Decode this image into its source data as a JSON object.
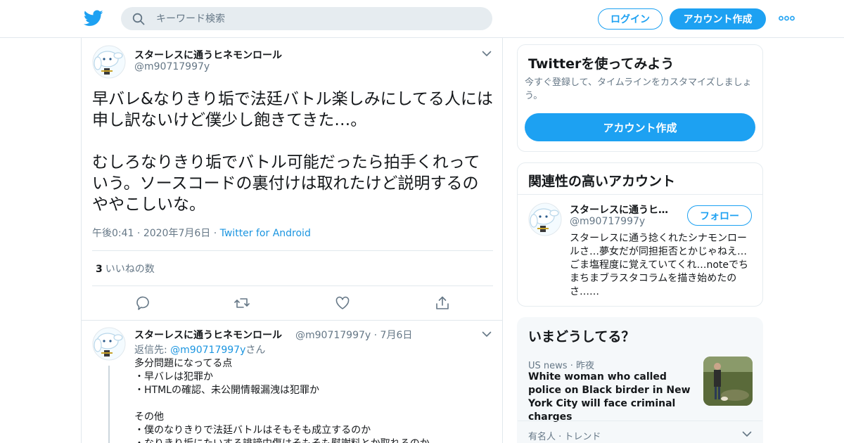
{
  "header": {
    "search_placeholder": "キーワード検索",
    "login_label": "ログイン",
    "signup_label": "アカウント作成"
  },
  "main_tweet": {
    "display_name": "スターレスに通うヒネモンロール",
    "handle": "@m90717997y",
    "text": "早バレ&なりきり垢で法廷バトル楽しみにしてる人には申し訳ないけど僕少し飽きてきた…。\n\nむしろなりきり垢でバトル可能だったら拍手くれっていう。ソースコードの裏付けは取れたけど説明するのややこしいな。",
    "time": "午後0:41",
    "date": "2020年7月6日",
    "source": "Twitter for Android",
    "like_count": "3",
    "like_label": "いいねの数"
  },
  "reply_tweet": {
    "display_name": "スターレスに通うヒネモンロール",
    "handle": "@m90717997y",
    "date": "7月6日",
    "reply_prefix": "返信先: ",
    "reply_to": "@m90717997y",
    "reply_suffix": "さん",
    "text": "多分問題になってる点\n・早バレは犯罪か\n・HTMLの確認、未公開情報漏洩は犯罪か\n\nその他\n・僕のなりきりで法廷バトルはそもそも成立するのか\n・なりきり垢にたいする誹謗中傷はそもそも慰謝料とか取れるのか"
  },
  "signup_card": {
    "title": "Twitterを使ってみよう",
    "subtitle": "今すぐ登録して、タイムラインをカスタマイズしましょう。",
    "button_label": "アカウント作成"
  },
  "related_card": {
    "title": "関連性の高いアカウント",
    "account": {
      "display_name": "スターレスに通うヒ…",
      "handle": "@m90717997y",
      "follow_label": "フォロー",
      "bio": "スターレスに通う捻くれたシナモンロールさ…夢女だが同担拒否とかじゃねえ…ごま塩程度に覚えていてくれ…noteでちまちまブラスタコラムを描き始めたのさ……"
    }
  },
  "trends_card": {
    "title": "いまどうしてる？",
    "item_category": "US news",
    "item_time": "昨夜",
    "item_headline": "White woman who called police on Black birder in New York City will face criminal charges",
    "next_category": "有名人",
    "next_type": "トレンド"
  },
  "colors": {
    "accent": "#1da1f2",
    "text": "#14171a",
    "muted": "#657786",
    "border": "#e1e8ed"
  }
}
